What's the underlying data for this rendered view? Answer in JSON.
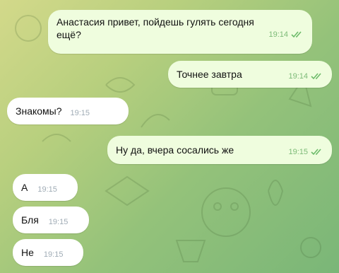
{
  "messages": [
    {
      "text": "Анастасия привет, пойдешь гулять сегодня",
      "text2": "ещё?",
      "time": "19:14",
      "direction": "outgoing",
      "read": true
    },
    {
      "text": "Точнее завтра",
      "time": "19:14",
      "direction": "outgoing",
      "read": true
    },
    {
      "text": "Знакомы?",
      "time": "19:15",
      "direction": "incoming"
    },
    {
      "text": "Ну да, вчера сосались же",
      "time": "19:15",
      "direction": "outgoing",
      "read": true
    },
    {
      "text": "А",
      "time": "19:15",
      "direction": "incoming"
    },
    {
      "text": "Бля",
      "time": "19:15",
      "direction": "incoming"
    },
    {
      "text": "Не",
      "time": "19:15",
      "direction": "incoming"
    }
  ],
  "colors": {
    "outgoing_bubble": "#effdde",
    "incoming_bubble": "#ffffff",
    "outgoing_meta": "#7dbb78",
    "incoming_meta": "#a0acb6"
  },
  "icons": [
    "double-check-icon"
  ]
}
